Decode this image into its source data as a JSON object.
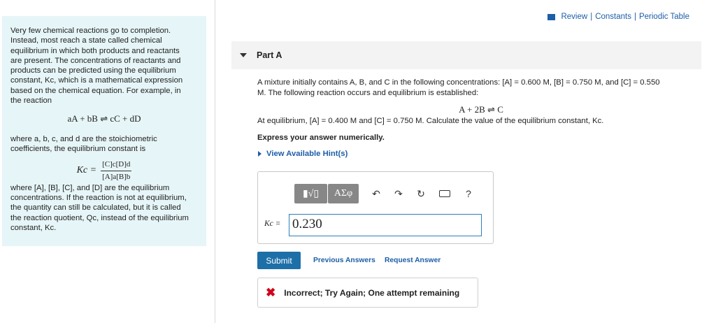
{
  "intro": {
    "p1": [
      "Very few chemical reactions go to completion.",
      "Instead, most reach a state called chemical",
      "equilibrium in which both products and reactants",
      "are present. The concentrations of reactants and",
      "products can be predicted using the equilibrium",
      "constant, Kc, which is a mathematical expression",
      "based on the chemical equation. For example, in",
      "the reaction"
    ],
    "general_reaction": "aA + bB ⇌ cC + dD",
    "p2": [
      "where a, b, c, and d are the stoichiometric",
      "coefficients, the equilibrium constant is"
    ],
    "kc_lhs": "Kc =",
    "kc_num": "[C]c[D]d",
    "kc_den": "[A]a[B]b",
    "p3": [
      "where [A], [B], [C], and [D] are the equilibrium",
      "concentrations. If the reaction is not at equilibrium,",
      "the quantity can still be calculated, but it is called",
      "the reaction quotient, Qc, instead of the equilibrium",
      "constant, Kc."
    ]
  },
  "top_links": {
    "review": "Review",
    "constants": "Constants",
    "periodic_table": "Periodic Table",
    "separator": "|"
  },
  "part": {
    "title": "Part A"
  },
  "question": {
    "line1": "A mixture initially contains A, B, and C in the following concentrations: [A] = 0.600 M, [B] = 0.750 M, and [C] = 0.550",
    "line2": "M. The following reaction occurs and equilibrium is established:",
    "reaction": "A + 2B ⇌ C",
    "line3": "At equilibrium, [A] = 0.400 M and [C] = 0.750 M. Calculate the value of the equilibrium constant, Kc.",
    "express": "Express your answer numerically.",
    "hint": "View Available Hint(s)"
  },
  "toolbar": {
    "templates_label": "▮√▯",
    "symbols_label": "ΑΣφ",
    "undo": "↶",
    "redo": "↷",
    "reset": "↻",
    "help": "?"
  },
  "answer": {
    "label": "Kc =",
    "value": "0.230"
  },
  "actions": {
    "submit": "Submit",
    "previous_answers": "Previous Answers",
    "request_answer": "Request Answer"
  },
  "feedback": {
    "icon": "✖",
    "text": "Incorrect; Try Again; One attempt remaining"
  },
  "colors": {
    "accent": "#1d6fa8",
    "panel_bg": "#e6f5f7",
    "error": "#d0021b"
  }
}
